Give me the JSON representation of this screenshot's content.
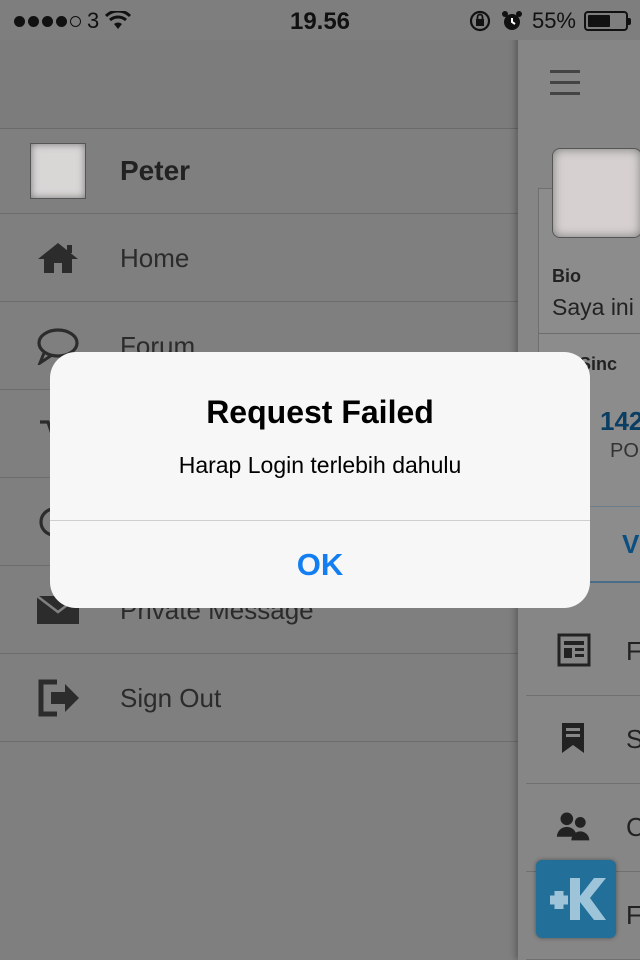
{
  "status_bar": {
    "carrier": "3",
    "time": "19.56",
    "battery": "55%",
    "battery_level": 0.55
  },
  "drawer": {
    "profile_name": "Peter",
    "items": [
      {
        "label": "Home",
        "icon": "home-icon"
      },
      {
        "label": "Forum",
        "icon": "speech-bubble-icon"
      },
      {
        "label": "",
        "icon": "cart-icon"
      },
      {
        "label": "",
        "icon": "chat-icon"
      },
      {
        "label": "Private Message",
        "icon": "envelope-icon"
      },
      {
        "label": "Sign Out",
        "icon": "sign-out-icon"
      }
    ]
  },
  "right_panel": {
    "bio_label": "Bio",
    "bio_text": "Saya ini",
    "member_since": "m Sinc",
    "post_count": "142",
    "posts_label": "PO",
    "button_text": "V",
    "menu_initials": [
      "F",
      "S",
      "C",
      "F"
    ]
  },
  "dialog": {
    "title": "Request Failed",
    "message": "Harap Login terlebih dahulu",
    "ok_label": "OK"
  },
  "colors": {
    "ok_button": "#137ef2",
    "overlay_bg": "#808080",
    "dialog_bg": "#f7f7f7",
    "kaskus_blue": "#226f99"
  }
}
